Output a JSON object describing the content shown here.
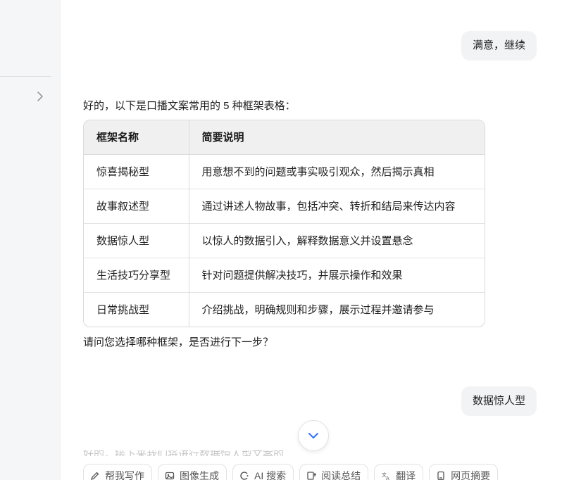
{
  "messages": {
    "user_1": "满意，继续",
    "assistant_intro": "好的，以下是口播文案常用的 5 种框架表格：",
    "assistant_question": "请问您选择哪种框架，是否进行下一步？",
    "user_2": "数据惊人型",
    "cutoff": "好的，接下来我们将进行数据惊人型文案的"
  },
  "table": {
    "headers": [
      "框架名称",
      "简要说明"
    ],
    "rows": [
      [
        "惊喜揭秘型",
        "用意想不到的问题或事实吸引观众，然后揭示真相"
      ],
      [
        "故事叙述型",
        "通过讲述人物故事，包括冲突、转折和结局来传达内容"
      ],
      [
        "数据惊人型",
        "以惊人的数据引入，解释数据意义并设置悬念"
      ],
      [
        "生活技巧分享型",
        "针对问题提供解决技巧，并展示操作和效果"
      ],
      [
        "日常挑战型",
        "介绍挑战，明确规则和步骤，展示过程并邀请参与"
      ]
    ]
  },
  "toolbar": {
    "items": [
      {
        "label": "帮我写作",
        "icon": "pen-icon"
      },
      {
        "label": "图像生成",
        "icon": "image-icon"
      },
      {
        "label": "AI 搜索",
        "icon": "search-icon"
      },
      {
        "label": "阅读总结",
        "icon": "read-icon"
      },
      {
        "label": "翻译",
        "icon": "translate-icon"
      },
      {
        "label": "网页摘要",
        "icon": "webpage-icon"
      }
    ]
  },
  "colors": {
    "accent": "#3370ff",
    "bubble": "#f2f3f5",
    "header_bg": "#f0f0f1"
  }
}
